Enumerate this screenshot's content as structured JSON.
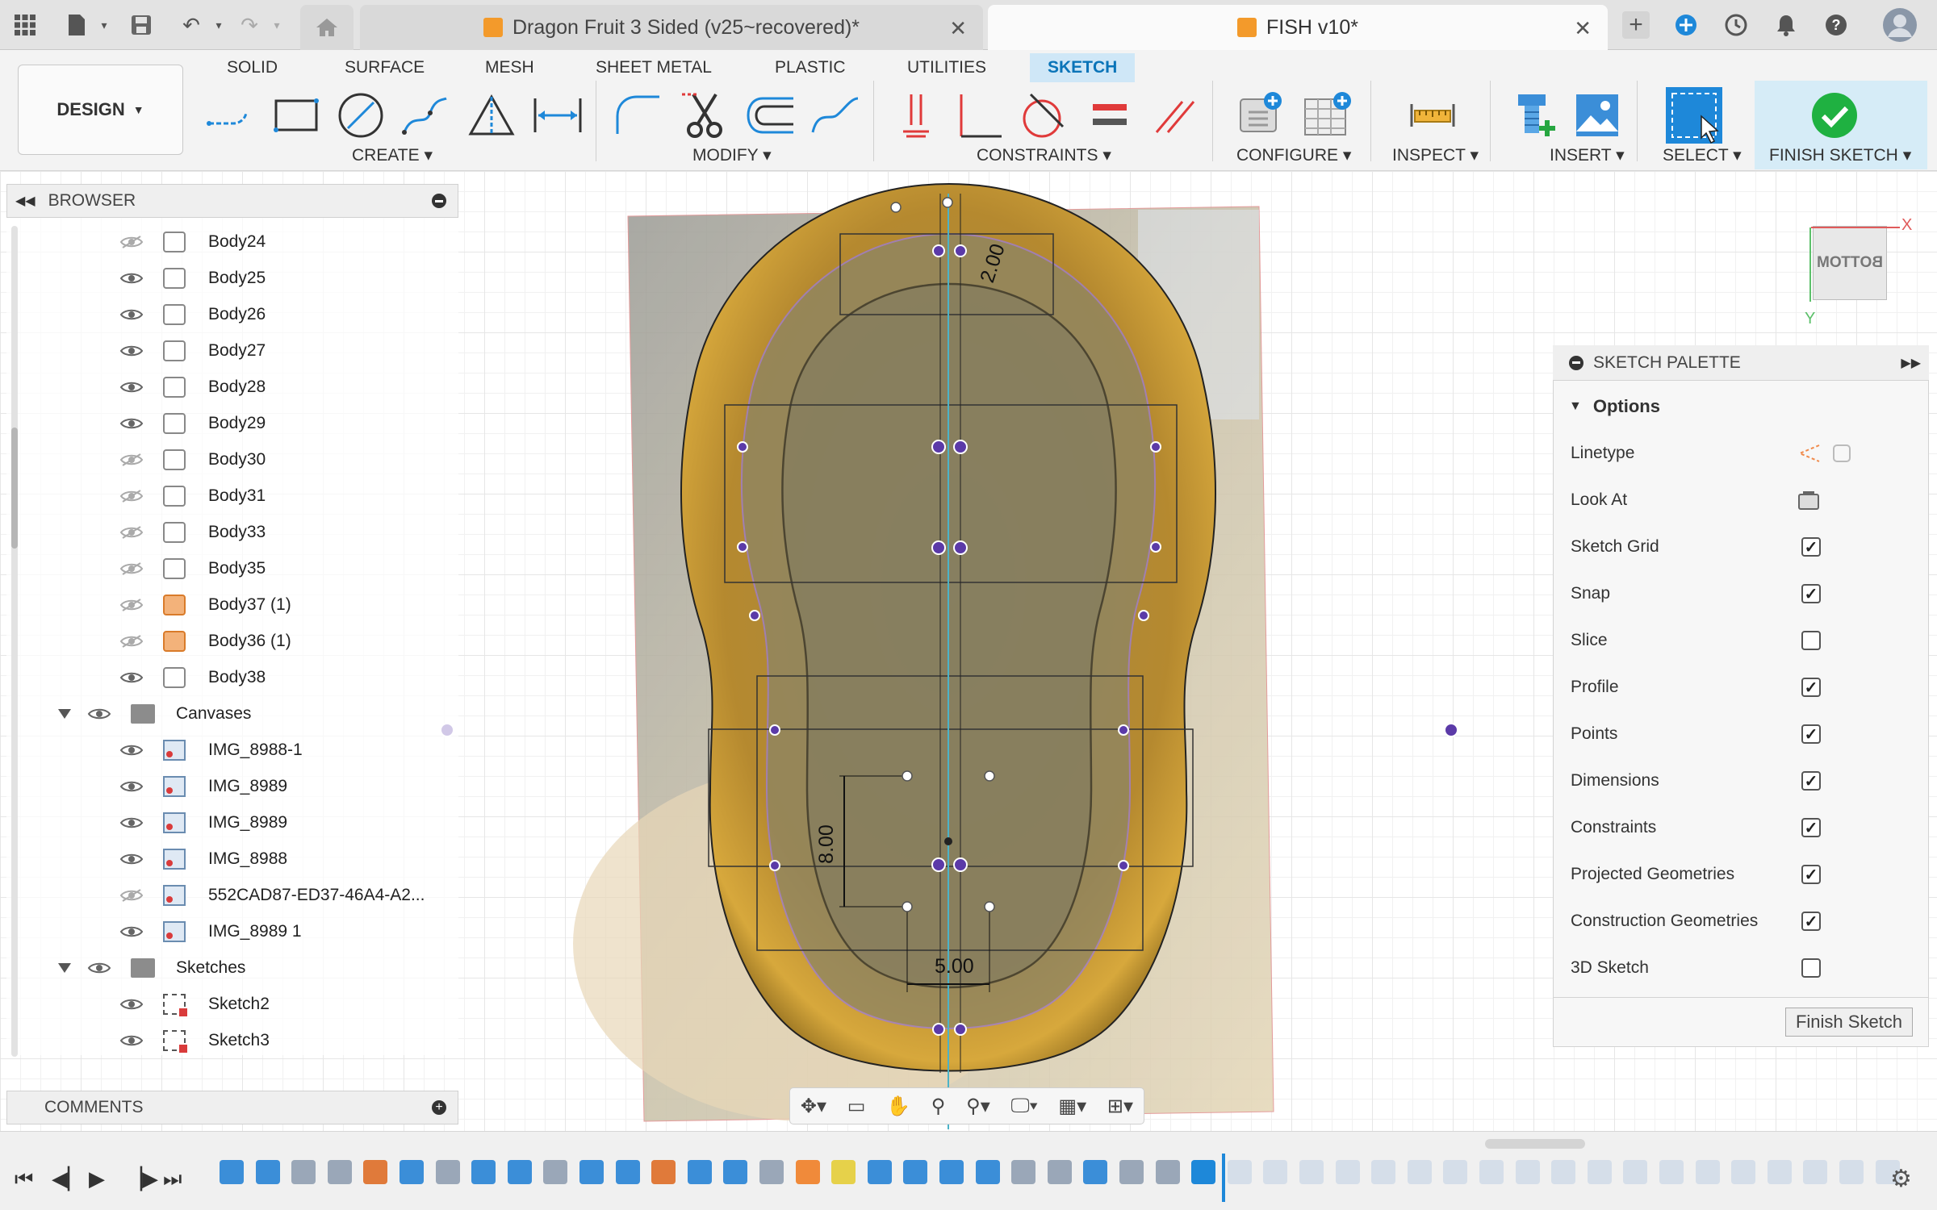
{
  "titlebar": {
    "tabs": [
      {
        "label": "Dragon Fruit 3 Sided (v25~recovered)*",
        "active": false
      },
      {
        "label": "FISH v10*",
        "active": true
      }
    ]
  },
  "toolbar": {
    "design_label": "DESIGN",
    "workspace_tabs": [
      "SOLID",
      "SURFACE",
      "MESH",
      "SHEET METAL",
      "PLASTIC",
      "UTILITIES",
      "SKETCH"
    ],
    "selected_workspace": "SKETCH",
    "groups": {
      "create": "CREATE",
      "modify": "MODIFY",
      "constraints": "CONSTRAINTS",
      "configure": "CONFIGURE",
      "inspect": "INSPECT",
      "insert": "INSERT",
      "select": "SELECT",
      "finish": "FINISH SKETCH"
    }
  },
  "browser": {
    "title": "BROWSER",
    "bodies": [
      {
        "label": "Body24",
        "visible": false,
        "color": "white"
      },
      {
        "label": "Body25",
        "visible": true,
        "color": "white"
      },
      {
        "label": "Body26",
        "visible": true,
        "color": "white"
      },
      {
        "label": "Body27",
        "visible": true,
        "color": "white"
      },
      {
        "label": "Body28",
        "visible": true,
        "color": "white"
      },
      {
        "label": "Body29",
        "visible": true,
        "color": "white"
      },
      {
        "label": "Body30",
        "visible": false,
        "color": "white"
      },
      {
        "label": "Body31",
        "visible": false,
        "color": "white"
      },
      {
        "label": "Body33",
        "visible": false,
        "color": "white"
      },
      {
        "label": "Body35",
        "visible": false,
        "color": "white"
      },
      {
        "label": "Body37 (1)",
        "visible": false,
        "color": "orange"
      },
      {
        "label": "Body36 (1)",
        "visible": false,
        "color": "orange"
      },
      {
        "label": "Body38",
        "visible": true,
        "color": "white"
      }
    ],
    "canvases_folder": "Canvases",
    "canvases": [
      {
        "label": "IMG_8988-1",
        "visible": true
      },
      {
        "label": "IMG_8989",
        "visible": true
      },
      {
        "label": "IMG_8989",
        "visible": true
      },
      {
        "label": "IMG_8988",
        "visible": true
      },
      {
        "label": "552CAD87-ED37-46A4-A2...",
        "visible": false
      },
      {
        "label": "IMG_8989 1",
        "visible": true
      }
    ],
    "sketches_folder": "Sketches",
    "sketches": [
      {
        "label": "Sketch2",
        "visible": true
      },
      {
        "label": "Sketch3",
        "visible": true
      }
    ],
    "comments": "COMMENTS"
  },
  "sketch": {
    "dimensions": [
      "2.00",
      "8.00",
      "5.00"
    ]
  },
  "viewcube": {
    "label": "BOTTOM",
    "x_axis": "X",
    "y_axis": "Y"
  },
  "palette": {
    "title": "SKETCH PALETTE",
    "section": "Options",
    "rows": [
      {
        "label": "Linetype",
        "type": "icon"
      },
      {
        "label": "Look At",
        "type": "icon"
      },
      {
        "label": "Sketch Grid",
        "checked": true
      },
      {
        "label": "Snap",
        "checked": true
      },
      {
        "label": "Slice",
        "checked": false
      },
      {
        "label": "Profile",
        "checked": true
      },
      {
        "label": "Points",
        "checked": true
      },
      {
        "label": "Dimensions",
        "checked": true
      },
      {
        "label": "Constraints",
        "checked": true
      },
      {
        "label": "Projected Geometries",
        "checked": true
      },
      {
        "label": "Construction Geometries",
        "checked": true
      },
      {
        "label": "3D Sketch",
        "checked": false
      }
    ],
    "finish_button": "Finish Sketch"
  },
  "colors": {
    "accent": "#0a74b8",
    "finish_green": "#1fb141",
    "sketch_profile": "#9b7cdc",
    "body_gold": "#c7962c"
  }
}
